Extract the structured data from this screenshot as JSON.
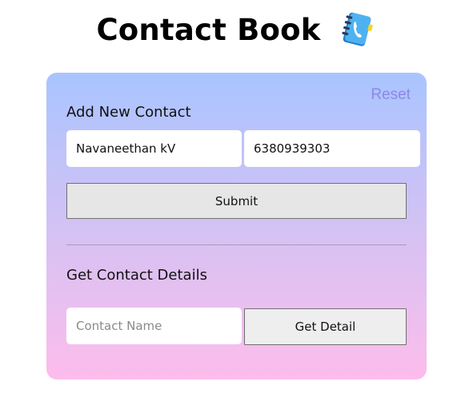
{
  "header": {
    "title": "Contact Book",
    "icon": "address-book-phone-icon"
  },
  "card": {
    "reset_label": "Reset",
    "add_section": {
      "heading": "Add New Contact",
      "name_value": "Navaneethan kV",
      "phone_value": "6380939303",
      "submit_label": "Submit"
    },
    "get_section": {
      "heading": "Get Contact Details",
      "name_placeholder": "Contact Name",
      "name_value": "",
      "get_label": "Get Detail"
    }
  },
  "colors": {
    "gradient_top": "#a9c4ff",
    "gradient_bottom": "#fdbcec",
    "reset_link": "#8d88e6",
    "icon_blue": "#3aa0e8",
    "icon_accent": "#ffd21f"
  }
}
